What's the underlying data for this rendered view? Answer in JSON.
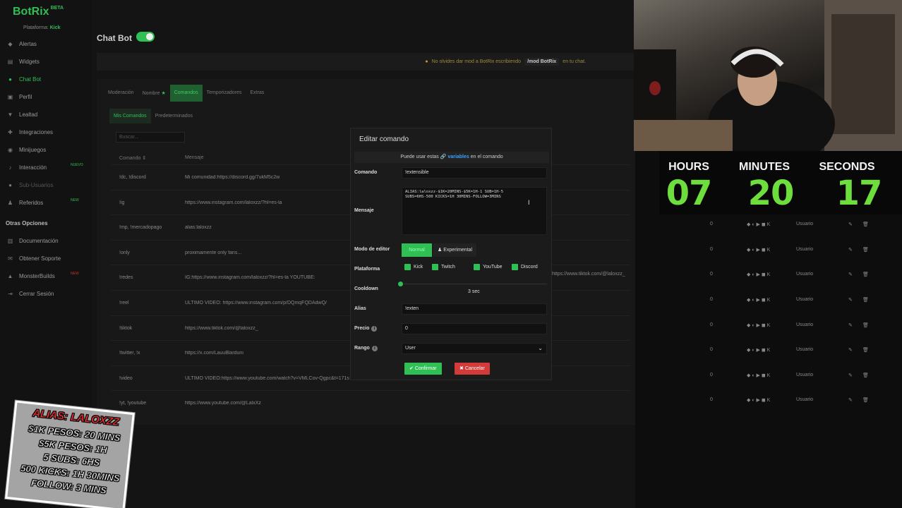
{
  "app": {
    "name": "BotRix",
    "beta": "BETA",
    "platform_label": "Plataforma:",
    "platform_value": "Kick"
  },
  "sidebar": {
    "items": [
      {
        "label": "Alertas",
        "icon": "bell-icon"
      },
      {
        "label": "Widgets",
        "icon": "layers-icon"
      },
      {
        "label": "Chat Bot",
        "icon": "chat-icon"
      },
      {
        "label": "Perfil",
        "icon": "user-card-icon"
      },
      {
        "label": "Lealtad",
        "icon": "trophy-icon"
      },
      {
        "label": "Integraciones",
        "icon": "puzzle-icon"
      },
      {
        "label": "Minijuegos",
        "icon": "gamepad-icon"
      },
      {
        "label": "Interacción",
        "icon": "music-icon",
        "badge": "NUEVO"
      },
      {
        "label": "Sub-Usuarios",
        "icon": "user-icon"
      },
      {
        "label": "Referidos",
        "icon": "users-icon",
        "badge": "NEW"
      }
    ],
    "section_title": "Otras Opciones",
    "other_items": [
      {
        "label": "Documentación",
        "icon": "book-icon"
      },
      {
        "label": "Obtener Soporte",
        "icon": "support-icon"
      },
      {
        "label": "MonsterBuilds",
        "icon": "monster-icon",
        "badge": "NEW"
      },
      {
        "label": "Cerrar Sesión",
        "icon": "logout-icon"
      }
    ]
  },
  "header": {
    "title": "Chat Bot"
  },
  "notice": {
    "text": "No olvides dar mod a BotRix escribiendo",
    "command": "/mod BotRix",
    "suffix": "en tu chat."
  },
  "tabs": [
    "Moderación",
    "Nombre",
    "Comandos",
    "Temporizadores",
    "Extras"
  ],
  "subtabs": [
    "Mis Comandos",
    "Predeterminados"
  ],
  "search_placeholder": "Buscar...",
  "table": {
    "headers": {
      "command": "Comando",
      "message": "Mensaje"
    },
    "rows": [
      {
        "command": "!dc, !discord",
        "message": "Mi comunidad:https://discord.gg/7ukM5c2w"
      },
      {
        "command": "!ig",
        "message": "https://www.instagram.com/laloxzz/?hl=es-la"
      },
      {
        "command": "!mp, !mercadopago",
        "message": "alias:laloxzz"
      },
      {
        "command": "!only",
        "message": "proximamente only fans..."
      },
      {
        "command": "!redes",
        "message": "IG:https://www.instagram.com/laloxzz/?hl=es-la YOUTUBE:",
        "message_right": "https://www.tiktok.com/@laloxzz_"
      },
      {
        "command": "!reel",
        "message": "ULTIMO VIDEO: https://www.instagram.com/p/DQmqFQDAdwQ/"
      },
      {
        "command": "!tiktok",
        "message": "https://www.tiktok.com/@laloxzz_"
      },
      {
        "command": "!twitter, !x",
        "message": "https://x.com/LauuBlarduni"
      },
      {
        "command": "!video",
        "message": "ULTIMO VIDEO:https://www.youtube.com/watch?v=VMLCov-Qgpc&t=171s"
      },
      {
        "command": "!yt, !youtube",
        "message": "https://www.youtube.com/@LalxXz"
      }
    ],
    "row_points": "0",
    "row_role": "Usuario"
  },
  "modal": {
    "title": "Editar comando",
    "info_prefix": "Puede usar estas",
    "info_link": "variables",
    "info_suffix": "en el comando",
    "labels": {
      "command": "Comando",
      "message": "Mensaje",
      "editor_mode": "Modo de editor",
      "platform": "Plataforma",
      "cooldown": "Cooldown",
      "alias": "Alias",
      "price": "Precio",
      "rank": "Rango"
    },
    "command_value": "!extensible",
    "message_value": "ALIAS:laloxzz-$1K=20MINS-$5K=1H-1 SUB=1H-5\nSUBS=6HS-500 KICKS=1H 30MINS-FOLLOW=3MINS",
    "editor_normal": "Normal",
    "editor_experimental": "Experimental",
    "platforms": [
      "Kick",
      "Twitch",
      "YouTube",
      "Discord"
    ],
    "cooldown_value": "3 sec",
    "cooldown_fraction": 0,
    "alias_value": "!exten",
    "price_value": "0",
    "rank_value": "User",
    "confirm": "Confirmar",
    "cancel": "Cancelar"
  },
  "timer": {
    "labels": [
      "HOURS",
      "MINUTES",
      "SECONDS"
    ],
    "values": [
      "07",
      "20",
      "17"
    ],
    "color": "#6dde3d"
  },
  "sticker": {
    "lines": [
      "ALIAS: LALOXZZ",
      "$1K PESOS: 20 MINS",
      "$5K PESOS: 1H",
      "5 SUBS: 6HS",
      "500 KICKS: 1H 30MINS",
      "FOLLOW: 3 MINS"
    ]
  },
  "colors": {
    "accent": "#2fbf55",
    "danger": "#d33a3a",
    "background": "#141414"
  }
}
